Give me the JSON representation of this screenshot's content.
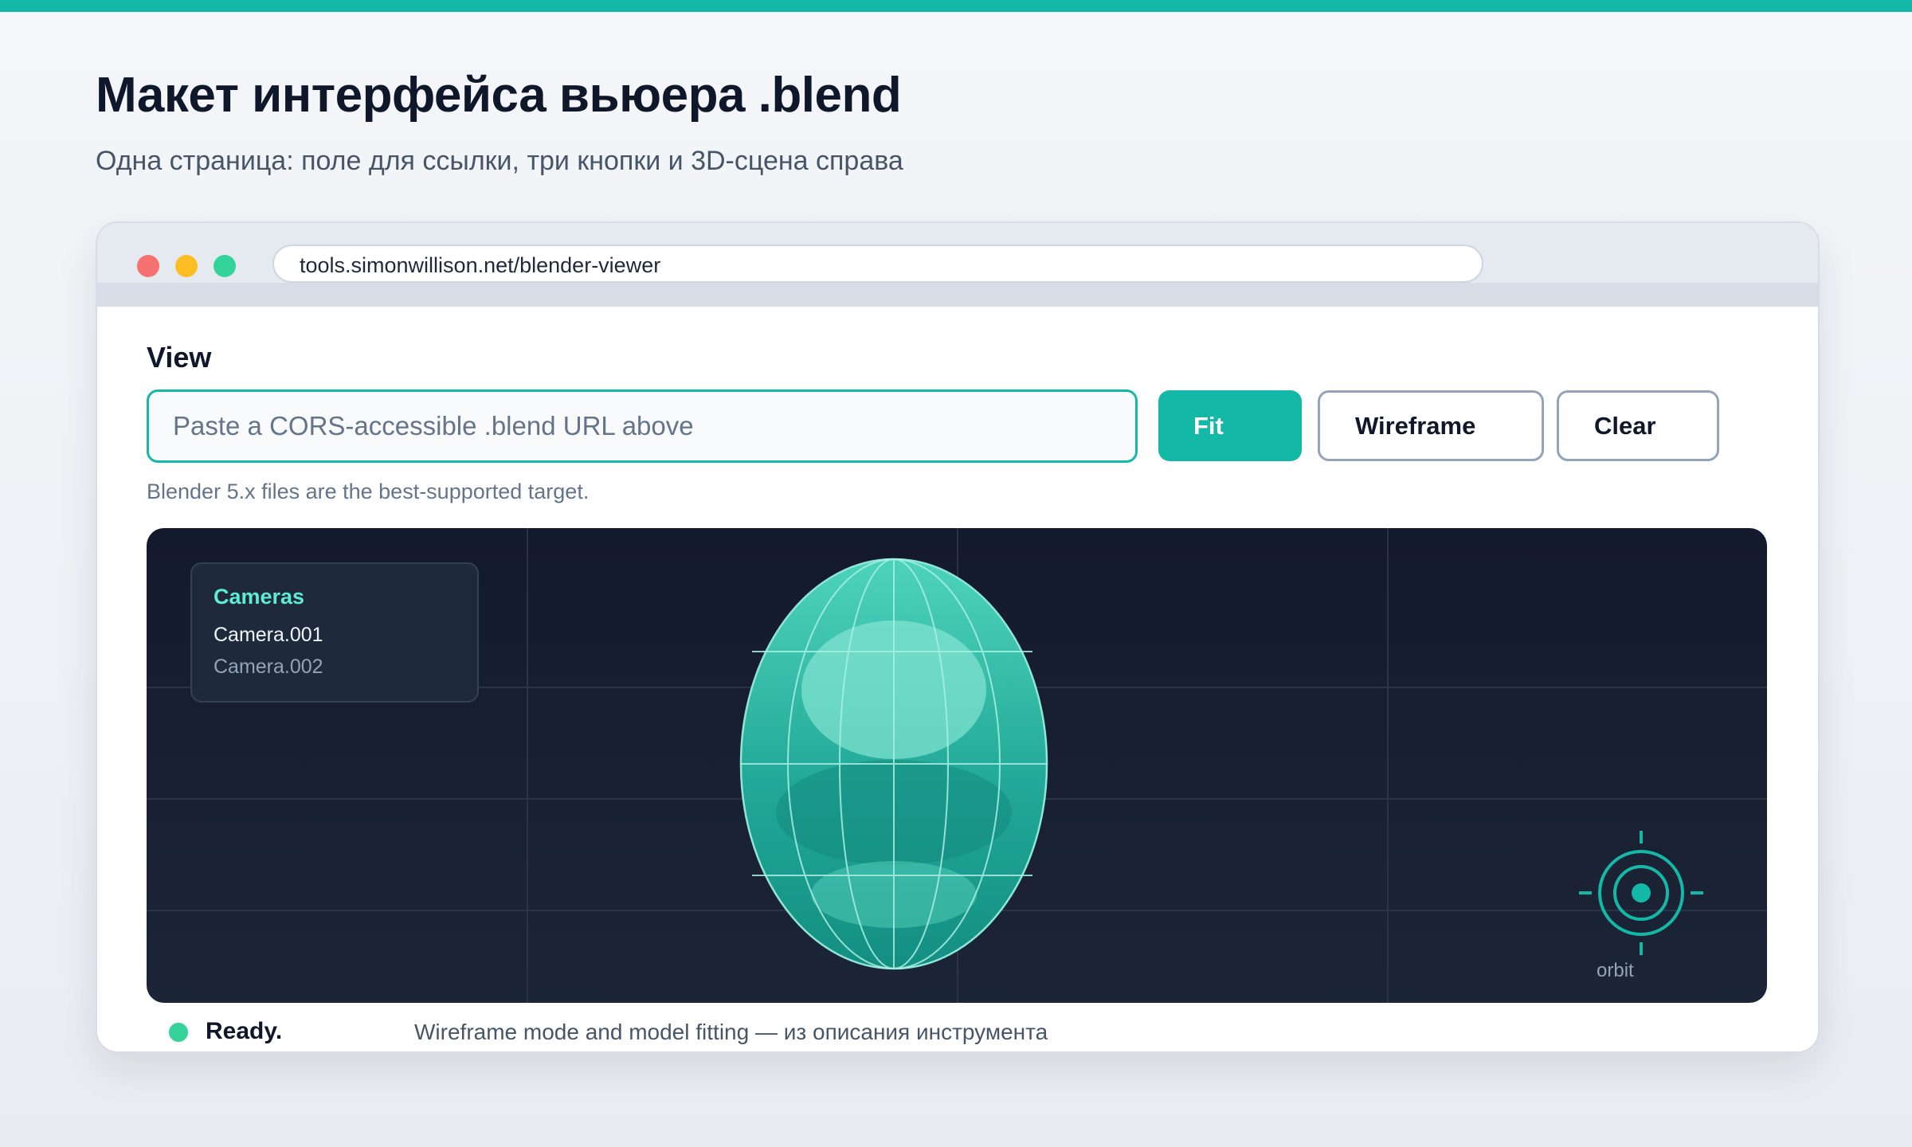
{
  "page": {
    "title": "Макет интерфейса вьюера .blend",
    "subtitle": "Одна страница: поле для ссылки, три кнопки и 3D-сцена справа"
  },
  "browser": {
    "url": "tools.simonwillison.net/blender-viewer",
    "window_controls": [
      "close",
      "minimize",
      "maximize"
    ]
  },
  "viewer": {
    "section_label": "View",
    "url_input": {
      "value": "",
      "placeholder": "Paste a CORS-accessible .blend URL above"
    },
    "buttons": {
      "fit": "Fit",
      "wireframe": "Wireframe",
      "clear": "Clear"
    },
    "hint": "Blender 5.x files are the best-supported target.",
    "cameras_panel": {
      "title": "Cameras",
      "items": [
        "Camera.001",
        "Camera.002"
      ],
      "selected": "Camera.001"
    },
    "orbit_label": "orbit"
  },
  "status": {
    "text": "Ready.",
    "note": "Wireframe mode and model fitting — из описания инструмента"
  },
  "colors": {
    "accent": "#14b8a6",
    "viewport_bg": "#161e2f",
    "model": "#2dd4bf",
    "status_ok": "#34d399",
    "camera_title": "#5eead4"
  }
}
